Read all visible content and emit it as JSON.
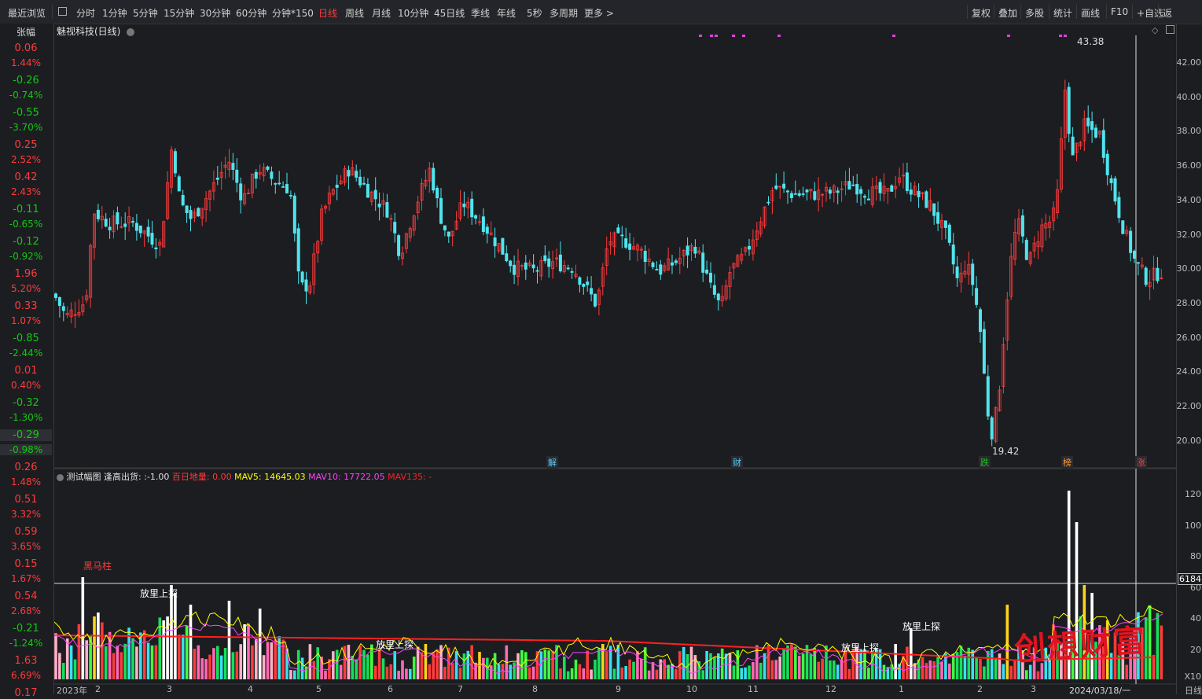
{
  "toolbar": {
    "recent": "最近浏览",
    "items": [
      "分时",
      "1分钟",
      "5分钟",
      "15分钟",
      "30分钟",
      "60分钟",
      "分钟*150",
      "日线",
      "周线",
      "月线",
      "10分钟",
      "45日线",
      "季线",
      "年线",
      "5秒",
      "多周期",
      "更多 >"
    ],
    "active": "日线",
    "right_items": [
      "复权",
      "叠加",
      "多股",
      "统计",
      "画线",
      "F10",
      "+自选",
      "返"
    ]
  },
  "left_panel": {
    "header": "张幅",
    "rows": [
      {
        "v": "0.06",
        "p": "1.44%",
        "c": "red"
      },
      {
        "v": "-0.26",
        "p": "-0.74%",
        "c": "green"
      },
      {
        "v": "-0.55",
        "p": "-3.70%",
        "c": "green"
      },
      {
        "v": "0.25",
        "p": "2.52%",
        "c": "red"
      },
      {
        "v": "0.42",
        "p": "2.43%",
        "c": "red"
      },
      {
        "v": "-0.11",
        "p": "-0.65%",
        "c": "green"
      },
      {
        "v": "-0.12",
        "p": "-0.92%",
        "c": "green"
      },
      {
        "v": "1.96",
        "p": "5.20%",
        "c": "red"
      },
      {
        "v": "0.33",
        "p": "1.07%",
        "c": "red"
      },
      {
        "v": "-0.85",
        "p": "-2.44%",
        "c": "green"
      },
      {
        "v": "0.01",
        "p": "0.40%",
        "c": "red"
      },
      {
        "v": "-0.32",
        "p": "-1.30%",
        "c": "green"
      },
      {
        "v": "-0.29",
        "p": "-0.98%",
        "c": "green"
      },
      {
        "v": "0.26",
        "p": "1.48%",
        "c": "red"
      },
      {
        "v": "0.51",
        "p": "3.32%",
        "c": "red"
      },
      {
        "v": "0.59",
        "p": "3.65%",
        "c": "red"
      },
      {
        "v": "0.15",
        "p": "1.67%",
        "c": "red"
      },
      {
        "v": "0.54",
        "p": "2.68%",
        "c": "red"
      },
      {
        "v": "-0.21",
        "p": "-1.24%",
        "c": "green"
      },
      {
        "v": "1.63",
        "p": "6.69%",
        "c": "red"
      },
      {
        "v": "0.17",
        "p": "",
        "c": "red"
      }
    ]
  },
  "main_chart": {
    "title": "魅视科技(日线)",
    "high_label": "43.38",
    "low_label": "19.42",
    "price_axis": [
      "42.00",
      "40.00",
      "38.00",
      "36.00",
      "34.00",
      "32.00",
      "30.00",
      "28.00",
      "26.00",
      "24.00",
      "22.00",
      "20.00"
    ],
    "event_tags": [
      {
        "t": "解",
        "c": "#4fd0ff"
      },
      {
        "t": "财",
        "c": "#4fd0ff"
      },
      {
        "t": "跌",
        "c": "#14c814"
      },
      {
        "t": "榜",
        "c": "#ff9a2e"
      },
      {
        "t": "涨",
        "c": "#ff3b3b"
      }
    ]
  },
  "volume_chart": {
    "name": "测试幅图",
    "f1_label": "逢高出货:",
    "f1_value": ":-1.00",
    "f2": "百日地量: 0.00",
    "mav5": "MAV5: 14645.03",
    "mav10": "MAV10: 17722.05",
    "mav135": "MAV135: -",
    "axis": [
      "120",
      "100",
      "80",
      "60",
      "40",
      "20"
    ],
    "axis_unit": "X10",
    "crosshair_value": "6184",
    "annotations": [
      "黑马柱",
      "放里上探",
      "放里上探",
      "放里上探",
      "放里上探"
    ]
  },
  "x_axis": [
    "2023年",
    "2",
    "3",
    "4",
    "5",
    "6",
    "7",
    "8",
    "9",
    "10",
    "11",
    "12",
    "1",
    "2",
    "3",
    "2024/03/18/一",
    "日线"
  ],
  "watermark": "创想财富",
  "colors": {
    "up": "#ff3b3b",
    "down": "#4fe5ee",
    "bg": "#1c1d21",
    "mav5": "#ffff00",
    "mav10": "#ff40ff",
    "mav135": "#ff2020",
    "magenta": "#e040e0"
  }
}
